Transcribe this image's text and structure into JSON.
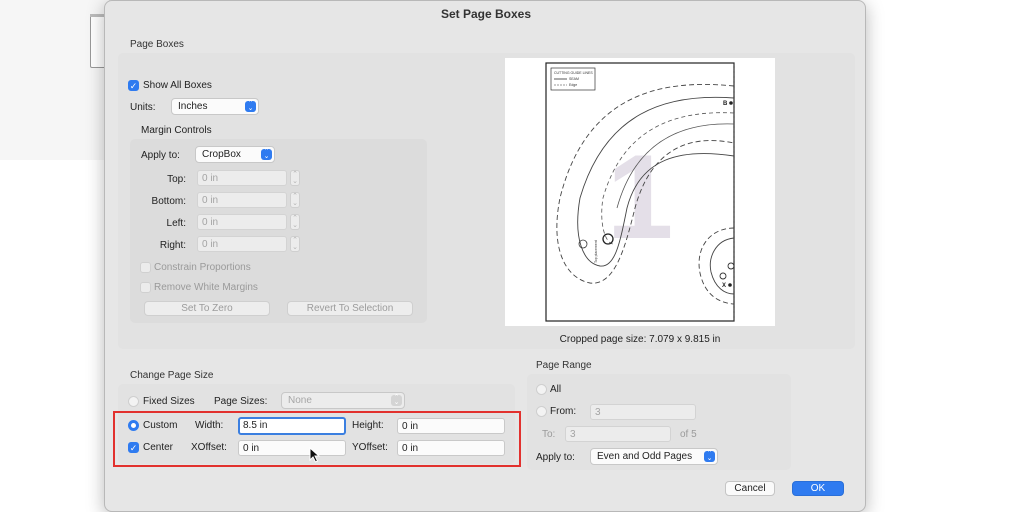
{
  "dialog": {
    "title": "Set Page Boxes"
  },
  "page_boxes": {
    "title": "Page Boxes",
    "show_all_boxes_label": "Show All Boxes",
    "units_label": "Units:",
    "units_value": "Inches",
    "margin_controls": {
      "title": "Margin Controls",
      "apply_to_label": "Apply to:",
      "apply_to_value": "CropBox",
      "top_label": "Top:",
      "top_value": "0 in",
      "bottom_label": "Bottom:",
      "bottom_value": "0 in",
      "left_label": "Left:",
      "left_value": "0 in",
      "right_label": "Right:",
      "right_value": "0 in",
      "constrain_label": "Constrain Proportions",
      "remove_white_label": "Remove White Margins",
      "set_to_zero_label": "Set To Zero",
      "revert_label": "Revert To Selection"
    }
  },
  "preview": {
    "cropped_size_label": "Cropped page size: 7.079 x 9.815 in",
    "watermark_number": "1",
    "legend_lines": [
      "CUTTING GUIDE LINES",
      "SEAM",
      "Edge"
    ],
    "marks": [
      "B",
      "X"
    ],
    "side_text": "Top placement"
  },
  "change_page_size": {
    "title": "Change Page Size",
    "fixed_sizes_label": "Fixed Sizes",
    "page_sizes_label": "Page Sizes:",
    "page_sizes_value": "None",
    "custom_label": "Custom",
    "width_label": "Width:",
    "width_value": "8.5 in",
    "height_label": "Height:",
    "height_value": "0 in",
    "center_label": "Center",
    "xoffset_label": "XOffset:",
    "xoffset_value": "0 in",
    "yoffset_label": "YOffset:",
    "yoffset_value": "0 in"
  },
  "page_range": {
    "title": "Page Range",
    "all_label": "All",
    "from_label": "From:",
    "from_value": "3",
    "to_label": "To:",
    "to_value": "3",
    "of_label": "of 5",
    "apply_to_label": "Apply to:",
    "apply_to_value": "Even and Odd Pages"
  },
  "footer": {
    "cancel_label": "Cancel",
    "ok_label": "OK"
  },
  "colors": {
    "accent": "#2f7bf0",
    "highlight": "#e2312e"
  }
}
